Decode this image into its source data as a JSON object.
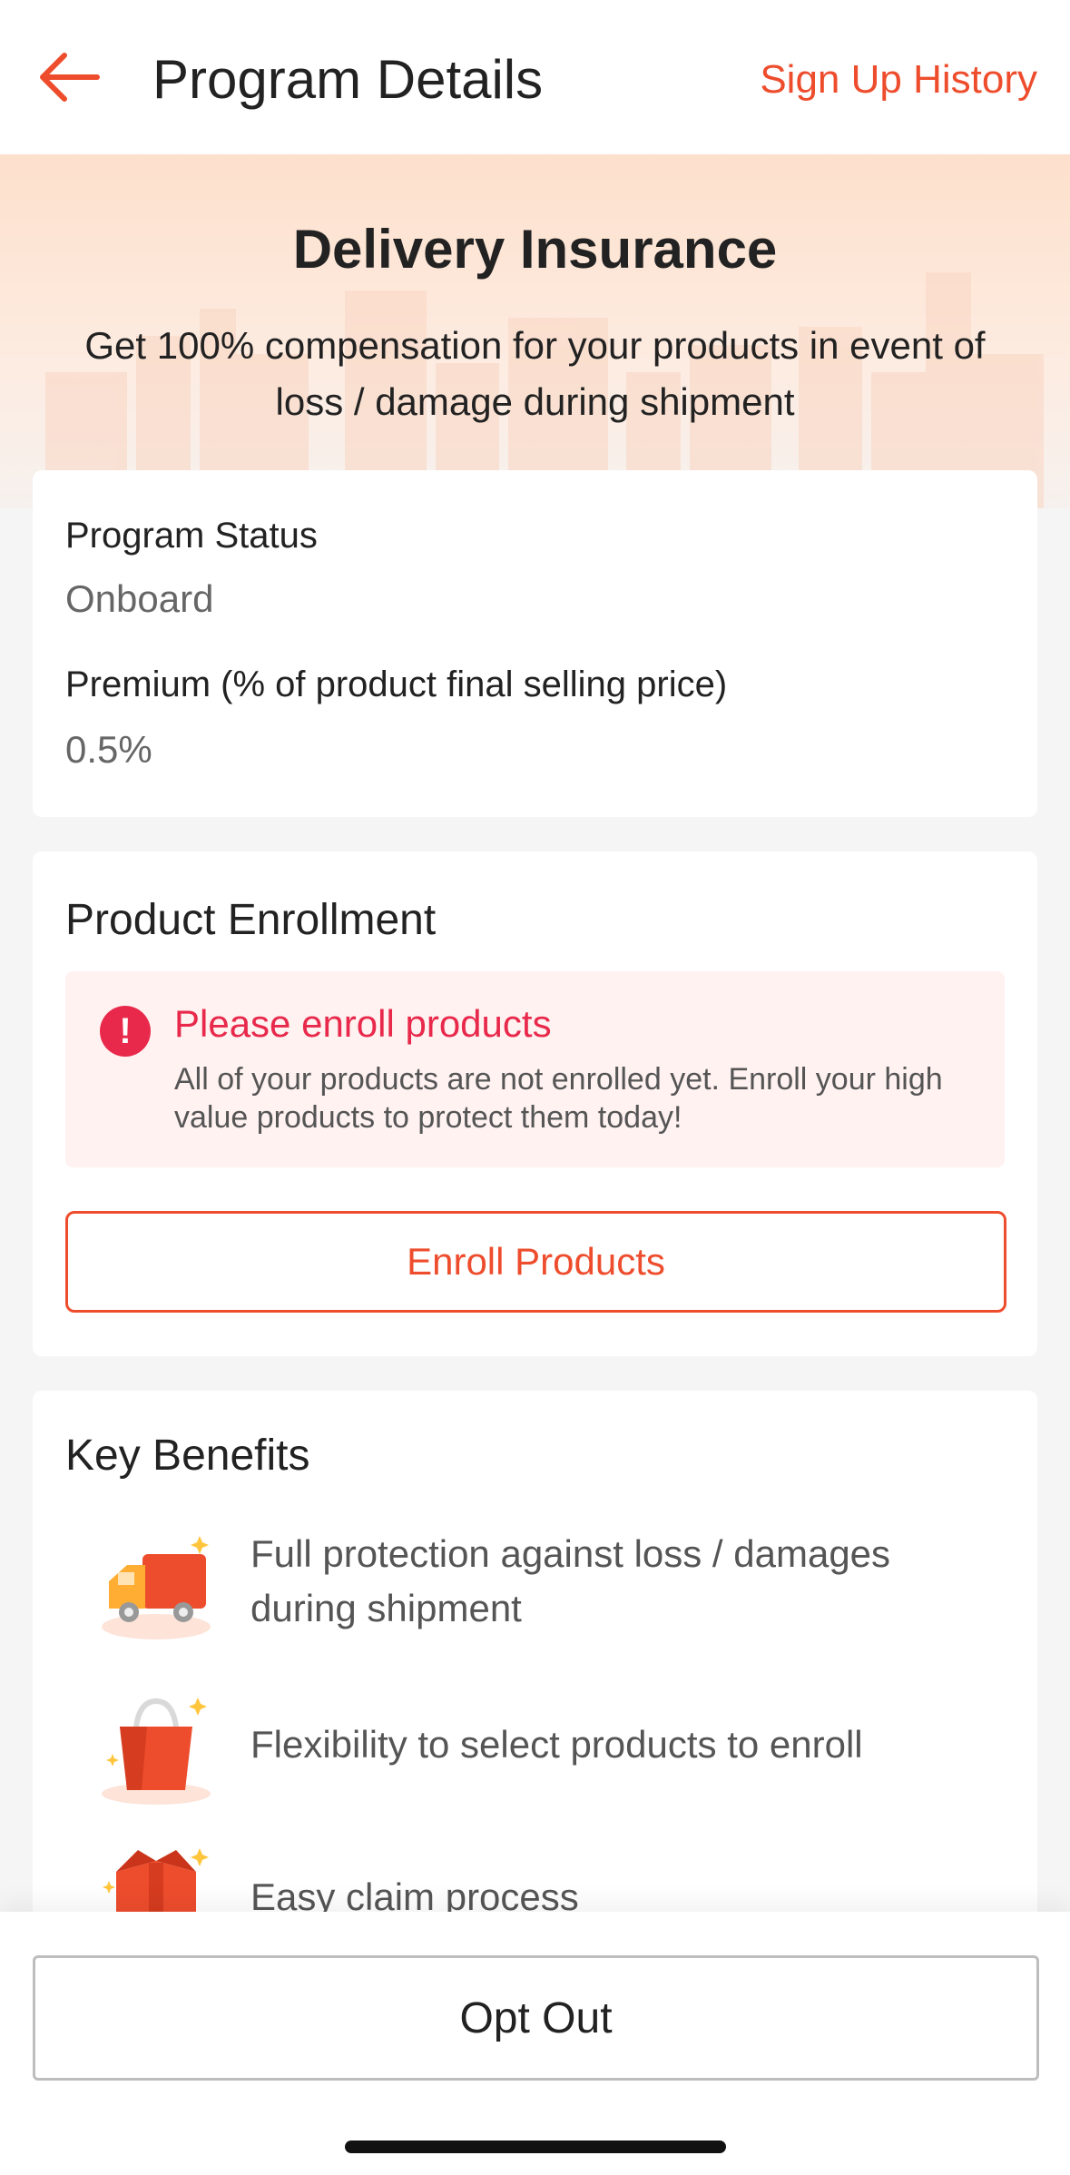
{
  "header": {
    "title": "Program Details",
    "history_label": "Sign Up History"
  },
  "hero": {
    "title": "Delivery Insurance",
    "subtitle": "Get 100% compensation for your products in event of loss / damage during shipment"
  },
  "status_card": {
    "status_label": "Program Status",
    "status_value": "Onboard",
    "premium_label": "Premium (% of product final selling price)",
    "premium_value": "0.5%"
  },
  "enrollment": {
    "title": "Product Enrollment",
    "alert_title": "Please enroll products",
    "alert_body": "All of your products are not enrolled yet. Enroll your high value products to protect them today!",
    "button_label": "Enroll Products"
  },
  "benefits": {
    "title": "Key Benefits",
    "items": [
      {
        "icon": "truck-icon",
        "text": "Full protection against loss / damages during shipment"
      },
      {
        "icon": "shopping-bag-icon",
        "text": "Flexibility to select products to enroll"
      },
      {
        "icon": "gift-box-icon",
        "text": "Easy claim process"
      }
    ]
  },
  "footer": {
    "optout_label": "Opt Out"
  },
  "colors": {
    "accent": "#ee4d2d",
    "alert": "#e8294b",
    "alert_bg": "#fff2f1"
  }
}
